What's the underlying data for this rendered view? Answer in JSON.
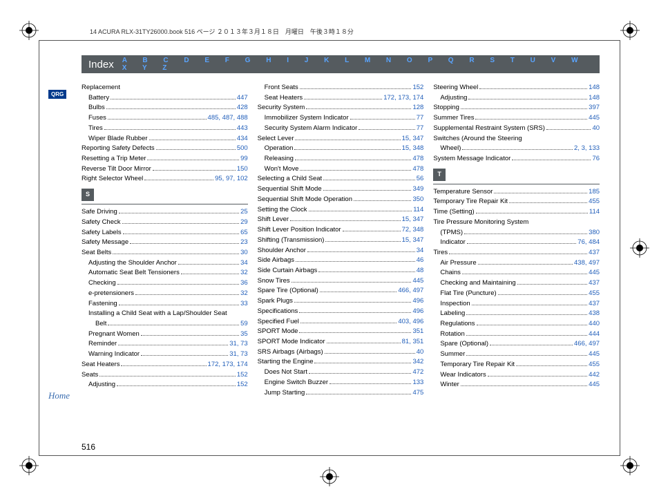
{
  "doc_header": "14 ACURA RLX-31TY26000.book  516 ページ  ２０１３年３月１８日　月曜日　午後３時１８分",
  "index_title": "Index",
  "alphabet": "A   B   C   D   E   F   G   H   I   J   K   L   M   N   O   P   Q   R   S   T   U   V   W   X   Y   Z",
  "qrg": "QRG",
  "home": "Home",
  "page_number": "516",
  "section_s": "S",
  "section_t": "T",
  "columns": [
    [
      {
        "l": "Replacement",
        "p": [],
        "lvl": 0,
        "nod": true
      },
      {
        "l": "Battery",
        "p": [
          "447"
        ],
        "lvl": 1
      },
      {
        "l": "Bulbs",
        "p": [
          "428"
        ],
        "lvl": 1
      },
      {
        "l": "Fuses",
        "p": [
          "485",
          "487",
          "488"
        ],
        "lvl": 1
      },
      {
        "l": "Tires",
        "p": [
          "443"
        ],
        "lvl": 1
      },
      {
        "l": "Wiper Blade Rubber",
        "p": [
          "434"
        ],
        "lvl": 1
      },
      {
        "l": "Reporting Safety Defects",
        "p": [
          "500"
        ],
        "lvl": 0
      },
      {
        "l": "Resetting a Trip Meter",
        "p": [
          "99"
        ],
        "lvl": 0
      },
      {
        "l": "Reverse Tilt Door Mirror",
        "p": [
          "150"
        ],
        "lvl": 0
      },
      {
        "l": "Right Selector Wheel",
        "p": [
          "95",
          "97",
          "102"
        ],
        "lvl": 0
      },
      {
        "section": "S"
      },
      {
        "l": "Safe Driving",
        "p": [
          "25"
        ],
        "lvl": 0
      },
      {
        "l": "Safety Check",
        "p": [
          "29"
        ],
        "lvl": 0
      },
      {
        "l": "Safety Labels",
        "p": [
          "65"
        ],
        "lvl": 0
      },
      {
        "l": "Safety Message",
        "p": [
          "23"
        ],
        "lvl": 0
      },
      {
        "l": "Seat Belts",
        "p": [
          "30"
        ],
        "lvl": 0
      },
      {
        "l": "Adjusting the Shoulder Anchor",
        "p": [
          "34"
        ],
        "lvl": 1
      },
      {
        "l": "Automatic Seat Belt Tensioners",
        "p": [
          "32"
        ],
        "lvl": 1
      },
      {
        "l": "Checking",
        "p": [
          "36"
        ],
        "lvl": 1
      },
      {
        "l": "e-pretensioners",
        "p": [
          "32"
        ],
        "lvl": 1
      },
      {
        "l": "Fastening",
        "p": [
          "33"
        ],
        "lvl": 1
      },
      {
        "l": "Installing a Child Seat with a Lap/Shoulder Seat",
        "p": [],
        "lvl": 1,
        "nod": true
      },
      {
        "l": "Belt",
        "p": [
          "59"
        ],
        "lvl": 2
      },
      {
        "l": "Pregnant Women",
        "p": [
          "35"
        ],
        "lvl": 1
      },
      {
        "l": "Reminder",
        "p": [
          "31",
          "73"
        ],
        "lvl": 1
      },
      {
        "l": "Warning Indicator",
        "p": [
          "31",
          "73"
        ],
        "lvl": 1
      },
      {
        "l": "Seat Heaters",
        "p": [
          "172",
          "173",
          "174"
        ],
        "lvl": 0
      },
      {
        "l": "Seats",
        "p": [
          "152"
        ],
        "lvl": 0
      },
      {
        "l": "Adjusting",
        "p": [
          "152"
        ],
        "lvl": 1
      }
    ],
    [
      {
        "l": "Front Seats",
        "p": [
          "152"
        ],
        "lvl": 1
      },
      {
        "l": "Seat Heaters",
        "p": [
          "172",
          "173",
          "174"
        ],
        "lvl": 1
      },
      {
        "l": "Security System",
        "p": [
          "128"
        ],
        "lvl": 0
      },
      {
        "l": "Immobilizer System Indicator",
        "p": [
          "77"
        ],
        "lvl": 1
      },
      {
        "l": "Security System Alarm Indicator",
        "p": [
          "77"
        ],
        "lvl": 1
      },
      {
        "l": "Select Lever",
        "p": [
          "15",
          "347"
        ],
        "lvl": 0
      },
      {
        "l": "Operation",
        "p": [
          "15",
          "348"
        ],
        "lvl": 1
      },
      {
        "l": "Releasing",
        "p": [
          "478"
        ],
        "lvl": 1
      },
      {
        "l": "Won't Move",
        "p": [
          "478"
        ],
        "lvl": 1
      },
      {
        "l": "Selecting a Child Seat",
        "p": [
          "56"
        ],
        "lvl": 0
      },
      {
        "l": "Sequential Shift Mode",
        "p": [
          "349"
        ],
        "lvl": 0
      },
      {
        "l": "Sequential Shift Mode Operation",
        "p": [
          "350"
        ],
        "lvl": 0
      },
      {
        "l": "Setting the Clock",
        "p": [
          "114"
        ],
        "lvl": 0
      },
      {
        "l": "Shift Lever",
        "p": [
          "15",
          "347"
        ],
        "lvl": 0
      },
      {
        "l": "Shift Lever Position Indicator",
        "p": [
          "72",
          "348"
        ],
        "lvl": 0
      },
      {
        "l": "Shifting (Transmission)",
        "p": [
          "15",
          "347"
        ],
        "lvl": 0
      },
      {
        "l": "Shoulder Anchor",
        "p": [
          "34"
        ],
        "lvl": 0
      },
      {
        "l": "Side Airbags",
        "p": [
          "46"
        ],
        "lvl": 0
      },
      {
        "l": "Side Curtain Airbags",
        "p": [
          "48"
        ],
        "lvl": 0
      },
      {
        "l": "Snow Tires",
        "p": [
          "445"
        ],
        "lvl": 0
      },
      {
        "l": "Spare Tire (Optional)",
        "p": [
          "466",
          "497"
        ],
        "lvl": 0
      },
      {
        "l": "Spark Plugs",
        "p": [
          "496"
        ],
        "lvl": 0
      },
      {
        "l": "Specifications",
        "p": [
          "496"
        ],
        "lvl": 0
      },
      {
        "l": "Specified Fuel",
        "p": [
          "403",
          "496"
        ],
        "lvl": 0
      },
      {
        "l": "SPORT Mode",
        "p": [
          "351"
        ],
        "lvl": 0
      },
      {
        "l": "SPORT Mode Indicator",
        "p": [
          "81",
          "351"
        ],
        "lvl": 0
      },
      {
        "l": "SRS Airbags (Airbags)",
        "p": [
          "40"
        ],
        "lvl": 0
      },
      {
        "l": "Starting the Engine",
        "p": [
          "342"
        ],
        "lvl": 0
      },
      {
        "l": "Does Not Start",
        "p": [
          "472"
        ],
        "lvl": 1
      },
      {
        "l": "Engine Switch Buzzer",
        "p": [
          "133"
        ],
        "lvl": 1
      },
      {
        "l": "Jump Starting",
        "p": [
          "475"
        ],
        "lvl": 1
      }
    ],
    [
      {
        "l": "Steering Wheel",
        "p": [
          "148"
        ],
        "lvl": 0
      },
      {
        "l": "Adjusting",
        "p": [
          "148"
        ],
        "lvl": 1
      },
      {
        "l": "Stopping",
        "p": [
          "397"
        ],
        "lvl": 0
      },
      {
        "l": "Summer Tires",
        "p": [
          "445"
        ],
        "lvl": 0
      },
      {
        "l": "Supplemental Restraint System (SRS)",
        "p": [
          "40"
        ],
        "lvl": 0
      },
      {
        "l": "Switches (Around the Steering",
        "p": [],
        "lvl": 0,
        "nod": true
      },
      {
        "l": "Wheel)",
        "p": [
          "2",
          "3",
          "133"
        ],
        "lvl": 1
      },
      {
        "l": "System Message Indicator",
        "p": [
          "76"
        ],
        "lvl": 0
      },
      {
        "section": "T"
      },
      {
        "l": "Temperature Sensor",
        "p": [
          "185"
        ],
        "lvl": 0
      },
      {
        "l": "Temporary Tire Repair Kit",
        "p": [
          "455"
        ],
        "lvl": 0
      },
      {
        "l": "Time (Setting)",
        "p": [
          "114"
        ],
        "lvl": 0
      },
      {
        "l": "Tire Pressure Monitoring System",
        "p": [],
        "lvl": 0,
        "nod": true
      },
      {
        "l": "(TPMS)",
        "p": [
          "380"
        ],
        "lvl": 1
      },
      {
        "l": "Indicator",
        "p": [
          "76",
          "484"
        ],
        "lvl": 1
      },
      {
        "l": "Tires",
        "p": [
          "437"
        ],
        "lvl": 0
      },
      {
        "l": "Air Pressure",
        "p": [
          "438",
          "497"
        ],
        "lvl": 1
      },
      {
        "l": "Chains",
        "p": [
          "445"
        ],
        "lvl": 1
      },
      {
        "l": "Checking and Maintaining",
        "p": [
          "437"
        ],
        "lvl": 1
      },
      {
        "l": "Flat Tire (Puncture)",
        "p": [
          "455"
        ],
        "lvl": 1
      },
      {
        "l": "Inspection",
        "p": [
          "437"
        ],
        "lvl": 1
      },
      {
        "l": "Labeling",
        "p": [
          "438"
        ],
        "lvl": 1
      },
      {
        "l": "Regulations",
        "p": [
          "440"
        ],
        "lvl": 1
      },
      {
        "l": "Rotation",
        "p": [
          "444"
        ],
        "lvl": 1
      },
      {
        "l": "Spare (Optional)",
        "p": [
          "466",
          "497"
        ],
        "lvl": 1
      },
      {
        "l": "Summer",
        "p": [
          "445"
        ],
        "lvl": 1
      },
      {
        "l": "Temporary Tire Repair Kit",
        "p": [
          "455"
        ],
        "lvl": 1
      },
      {
        "l": "Wear Indicators",
        "p": [
          "442"
        ],
        "lvl": 1
      },
      {
        "l": "Winter",
        "p": [
          "445"
        ],
        "lvl": 1
      }
    ]
  ]
}
